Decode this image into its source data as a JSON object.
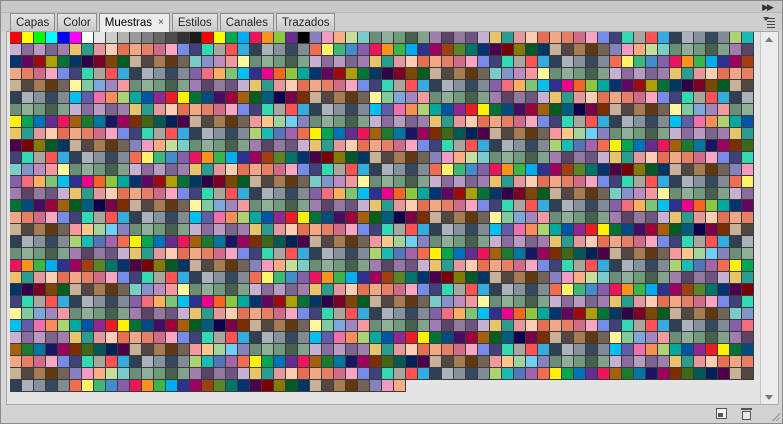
{
  "tabs": [
    {
      "label": "Capas",
      "active": false
    },
    {
      "label": "Color",
      "active": false
    },
    {
      "label": "Muestras",
      "active": true,
      "close_glyph": "×"
    },
    {
      "label": "Estilos",
      "active": false
    },
    {
      "label": "Canales",
      "active": false
    },
    {
      "label": "Trazados",
      "active": false
    }
  ],
  "icons": {
    "collapse": "double-chevron-right-icon",
    "panel_menu": "panel-menu-icon",
    "new_swatch": "new-swatch-icon",
    "delete": "trash-icon",
    "scroll_up": "scroll-up-arrow-icon",
    "scroll_down": "scroll-down-arrow-icon",
    "resize": "resize-grip-icon"
  },
  "swatches": {
    "columns": 62,
    "rows": 30,
    "last_row_count": 33,
    "first_row_colors": [
      "#ff0000",
      "#ffff00",
      "#00ff00",
      "#00ffff",
      "#0000ff",
      "#ff00ff",
      "#ffffff",
      "#e6e6e6",
      "#cccccc",
      "#b3b3b3",
      "#999999",
      "#808080",
      "#666666",
      "#4d4d4d",
      "#333333",
      "#1a1a1a",
      "#ff0000",
      "#ffff00",
      "#00a651",
      "#00aeef",
      "#ed145b",
      "#f7941d",
      "#8dc63f",
      "#662d91",
      "#000000"
    ],
    "row_palettes": [
      [
        "#f26c4f",
        "#f68e56",
        "#fbaf5c",
        "#fff467",
        "#acd372",
        "#7cc576",
        "#3bb878",
        "#1abbb4",
        "#00bff3",
        "#438ccb",
        "#5574b9",
        "#605ca8",
        "#855fa8",
        "#a763a9",
        "#f06ea9",
        "#f26d7d"
      ],
      [
        "#ed1c24",
        "#f26522",
        "#f7941d",
        "#fff200",
        "#8dc63f",
        "#39b54a",
        "#00a651",
        "#00a99d",
        "#00aeef",
        "#0072bc",
        "#0054a6",
        "#2e3192",
        "#662d91",
        "#92278f",
        "#ec008c",
        "#ed145b"
      ],
      [
        "#9e0b0f",
        "#a0410d",
        "#a3620a",
        "#aba000",
        "#598527",
        "#1a7b30",
        "#007236",
        "#00746b",
        "#0076a3",
        "#004b80",
        "#003471",
        "#1b1464",
        "#440e62",
        "#630460",
        "#9e005d",
        "#9e0039"
      ],
      [
        "#790000",
        "#7b2e00",
        "#7d4900",
        "#827b00",
        "#406618",
        "#005e20",
        "#005826",
        "#005952",
        "#005b7f",
        "#003663",
        "#002157",
        "#0d004c",
        "#32004b",
        "#4b0049",
        "#7b0046",
        "#7a0026"
      ],
      [
        "#c7b299",
        "#998675",
        "#736357",
        "#534741",
        "#37302d",
        "#c69c6d",
        "#a67c52",
        "#8c6239",
        "#754c24",
        "#603913"
      ],
      [
        "#f5989d",
        "#f9ad81",
        "#fdc68a",
        "#fff799",
        "#c4df9b",
        "#a3d39c",
        "#82ca9c",
        "#7accc8",
        "#6dcff6",
        "#7da7d9",
        "#8393ca",
        "#8781bd",
        "#a186be",
        "#bd8cbf",
        "#f49ac1",
        "#f5989d"
      ],
      [
        "#6b8e76",
        "#5f7d6a",
        "#7fa38b",
        "#8fb098",
        "#4f6b5c",
        "#9bbfa5",
        "#6f9a7e",
        "#587e67",
        "#a8c4ae",
        "#46624f"
      ],
      [
        "#8a6b9e",
        "#a07cb0",
        "#6e5480",
        "#b69ac2",
        "#5a4468",
        "#c7b0d1",
        "#7d6490",
        "#93789f"
      ],
      [
        "#e9c46a",
        "#f4a261",
        "#e76f51",
        "#2a9d8f",
        "#264653",
        "#ffb4a2",
        "#e5989b",
        "#b5838d",
        "#6d6875",
        "#ffcdb2"
      ],
      [
        "#c44569",
        "#cf6a87",
        "#574b90",
        "#786fa6",
        "#f8a5c2",
        "#f3a683",
        "#f7d794",
        "#778beb",
        "#e77f67",
        "#63cdda"
      ],
      [
        "#40407a",
        "#706fd3",
        "#34ace0",
        "#33d9b2",
        "#2c2c54",
        "#474787",
        "#aaa69d",
        "#227093",
        "#218c74",
        "#ff5252"
      ],
      [
        "#5d6d7e",
        "#85929e",
        "#aeb6bf",
        "#d6dbdf",
        "#34495e",
        "#2e4053",
        "#566573",
        "#808b96",
        "#abb2b9",
        "#d5d8dc"
      ]
    ]
  }
}
